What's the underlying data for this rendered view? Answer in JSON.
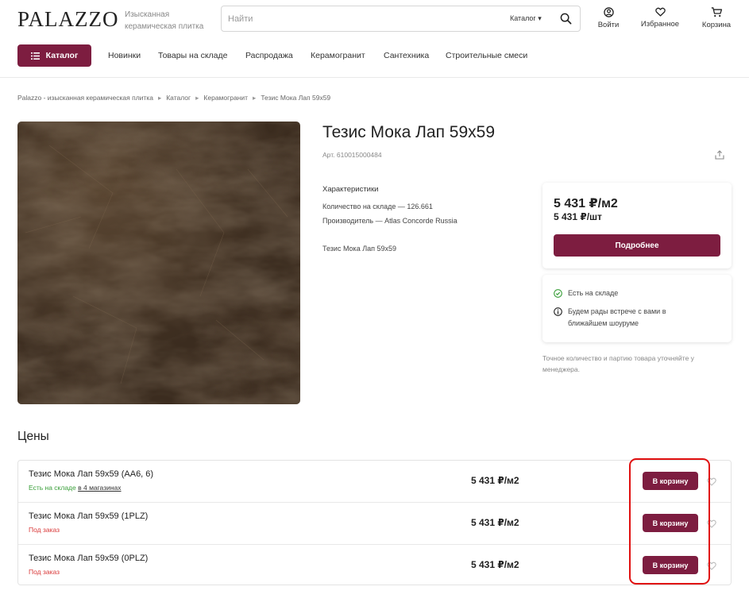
{
  "header": {
    "logo": "PALAZZO",
    "tagline": "Изысканная керамическая плитка",
    "search_placeholder": "Найти",
    "search_category": "Каталог ▾",
    "actions": {
      "login": "Войти",
      "favorites": "Избранное",
      "cart": "Корзина"
    }
  },
  "nav": {
    "catalog_button": "Каталог",
    "links": [
      "Новинки",
      "Товары на складе",
      "Распродажа",
      "Керамогранит",
      "Сантехника",
      "Строительные смеси"
    ]
  },
  "breadcrumb": [
    "Palazzo - изысканная керамическая плитка",
    "Каталог",
    "Керамогранит",
    "Тезис Мока Лап 59x59"
  ],
  "product": {
    "title": "Тезис Мока Лап 59x59",
    "article": "Арт. 610015000484",
    "characteristics_title": "Характеристики",
    "characteristics": [
      "Количество на складе — 126.661",
      "Производитель — Atlas Concorde Russia"
    ],
    "short_description": "Тезис Мока Лап 59x59"
  },
  "price_card": {
    "price_m2": "5 431 ₽/м2",
    "price_piece": "5 431 ₽/шт",
    "more_button": "Подробнее"
  },
  "stock_card": {
    "in_stock": "Есть на складе",
    "showroom_line1": "Будем рады встрече с вами в",
    "showroom_line2": "ближайшем шоуруме"
  },
  "note": "Точное количество и партию товара уточняйте у менеджера.",
  "prices_section": {
    "title": "Цены",
    "rows": [
      {
        "name": "Тезис Мока Лап 59x59 (AA6, 6)",
        "status": "Есть на складе",
        "status_link": "в 4 магазинах",
        "price": "5 431 ₽/м2",
        "button": "В корзину"
      },
      {
        "name": "Тезис Мока Лап 59x59 (1PLZ)",
        "status": "Под заказ",
        "status_link": "",
        "price": "5 431 ₽/м2",
        "button": "В корзину"
      },
      {
        "name": "Тезис Мока Лап 59x59 (0PLZ)",
        "status": "Под заказ",
        "status_link": "",
        "price": "5 431 ₽/м2",
        "button": "В корзину"
      }
    ]
  },
  "colors": {
    "brand": "#7d1d40",
    "in_stock": "#3a9f3a",
    "on_order": "#d93a3a",
    "highlight": "#e01010"
  },
  "icons": [
    "search-icon",
    "user-icon",
    "heart-icon",
    "cart-icon",
    "menu-icon",
    "share-icon",
    "check-circle-icon",
    "info-icon"
  ]
}
